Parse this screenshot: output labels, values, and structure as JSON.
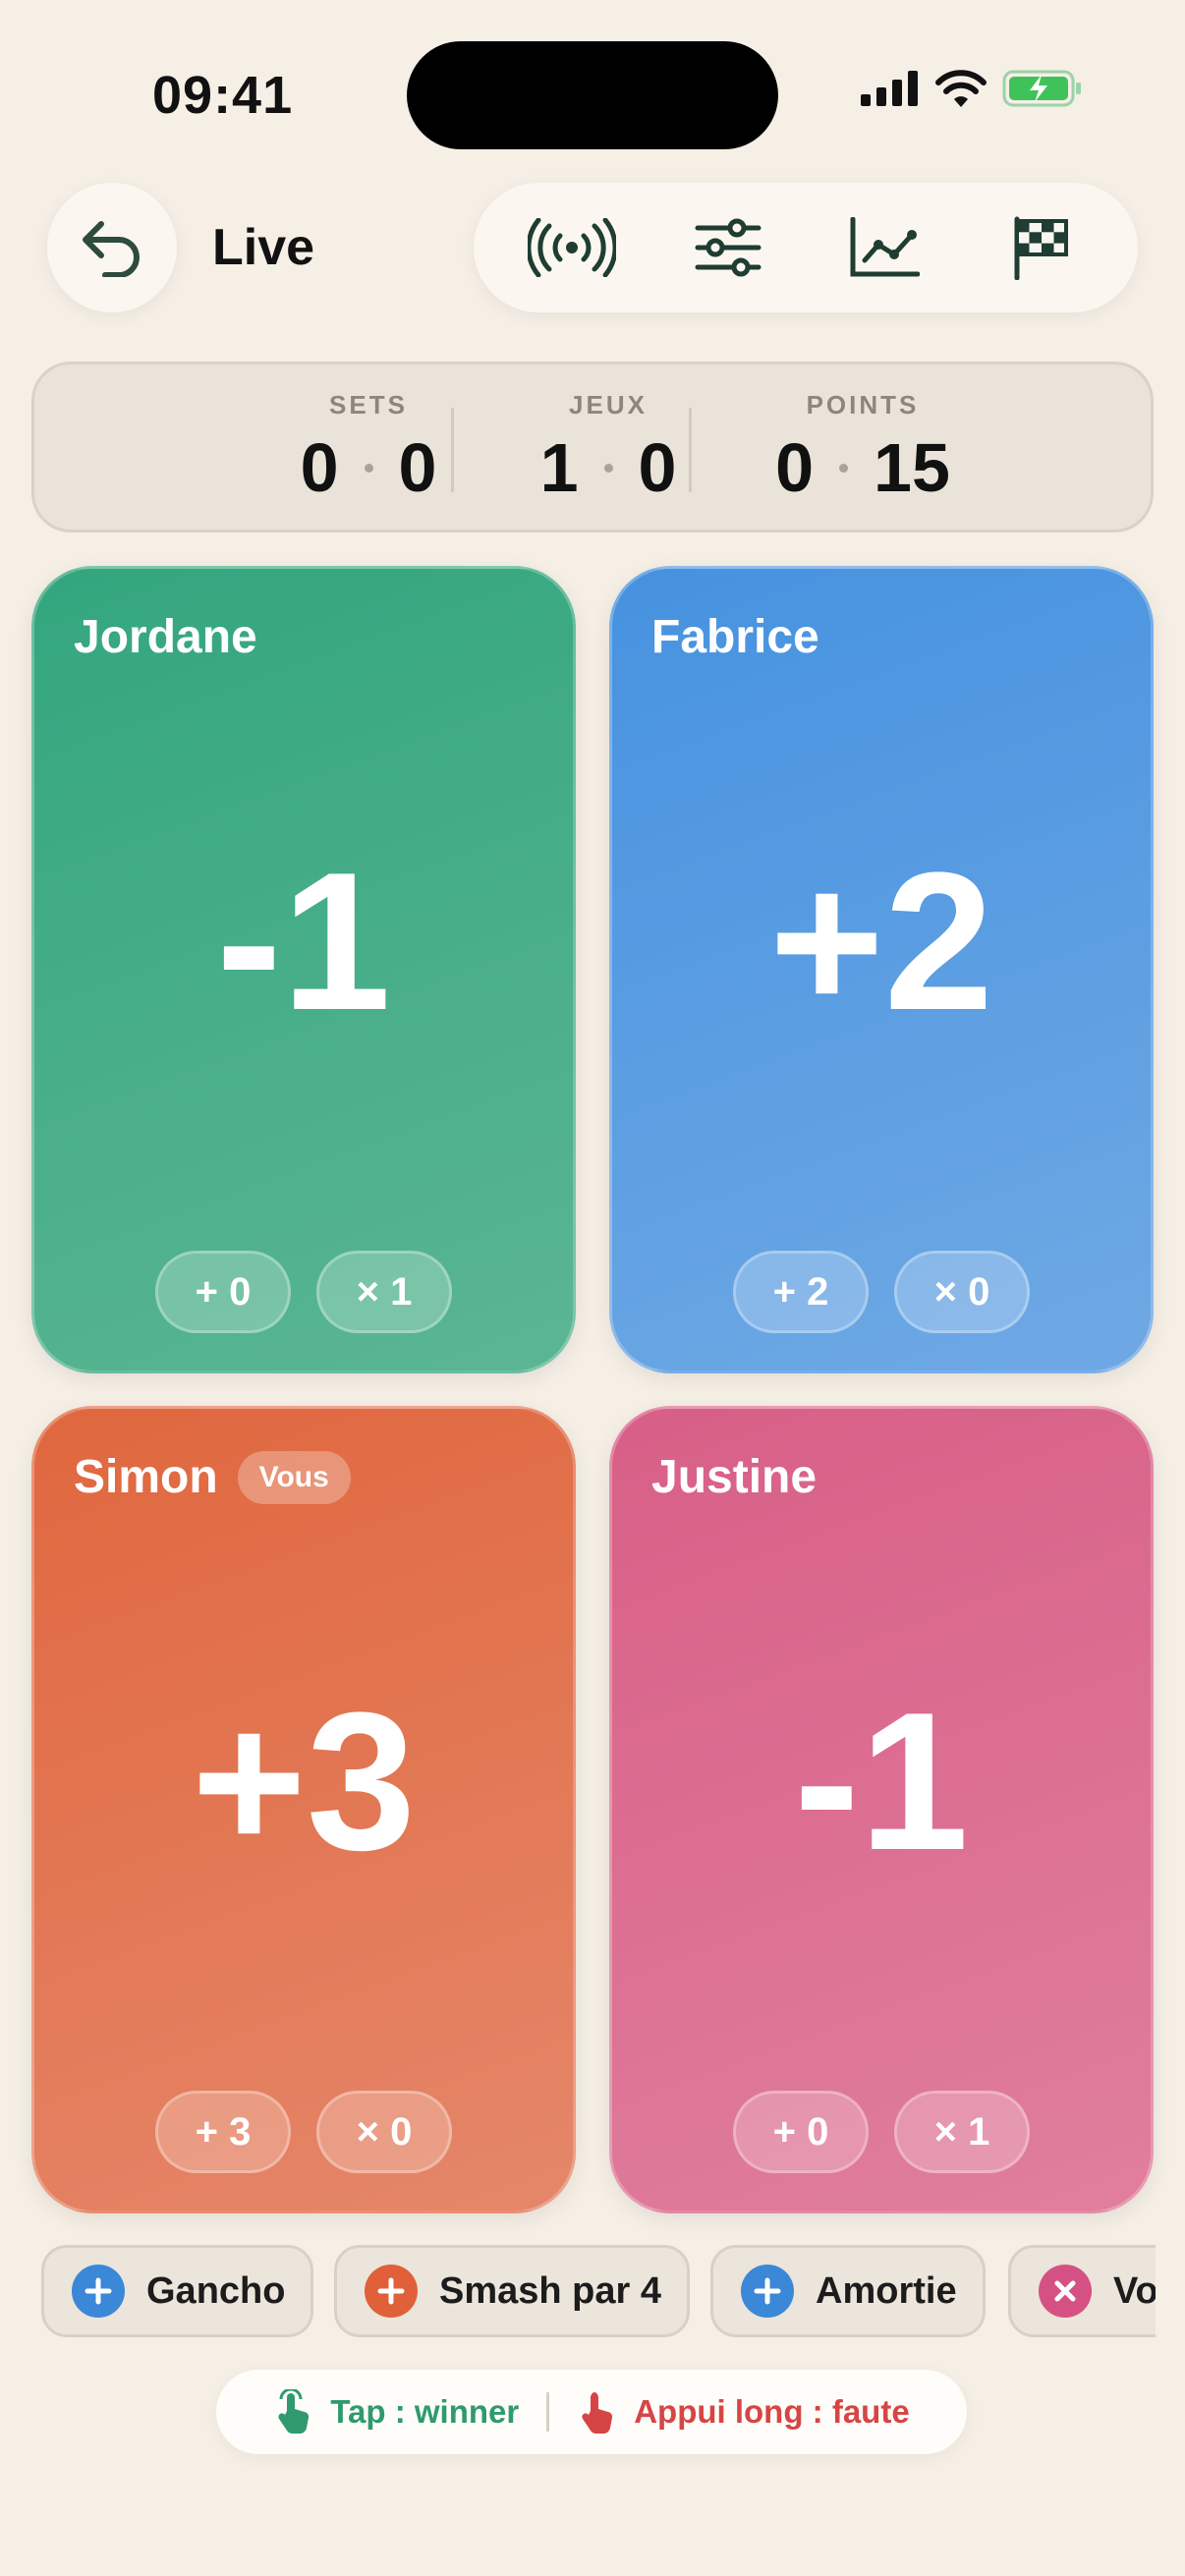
{
  "status_bar": {
    "time": "09:41"
  },
  "header": {
    "title": "Live"
  },
  "toolbar": {
    "icons": [
      "broadcast-icon",
      "sliders-icon",
      "chart-icon",
      "checkered-flag-icon"
    ]
  },
  "scoreboard": {
    "sets": {
      "label": "SETS",
      "a": "0",
      "b": "0"
    },
    "games": {
      "label": "JEUX",
      "a": "1",
      "b": "0"
    },
    "points": {
      "label": "POINTS",
      "a": "0",
      "b": "15"
    }
  },
  "players": [
    {
      "name": "Jordane",
      "score": "-1",
      "winners": "+ 0",
      "faults": "× 1",
      "color": "#3aa882"
    },
    {
      "name": "Fabrice",
      "score": "+2",
      "winners": "+ 2",
      "faults": "× 0",
      "color": "#4a94e0"
    },
    {
      "name": "Simon",
      "badge": "Vous",
      "score": "+3",
      "winners": "+ 3",
      "faults": "× 0",
      "color": "#e06b43"
    },
    {
      "name": "Justine",
      "score": "-1",
      "winners": "+ 0",
      "faults": "× 1",
      "color": "#d9638b"
    }
  ],
  "shots": [
    {
      "label": "Gancho",
      "type": "winner",
      "color": "#3b87d8"
    },
    {
      "label": "Smash par 4",
      "type": "winner",
      "color": "#e0603a"
    },
    {
      "label": "Amortie",
      "type": "winner",
      "color": "#3b87d8"
    },
    {
      "label": "Vo",
      "type": "fault",
      "color": "#d65183"
    }
  ],
  "hint": {
    "tap": "Tap : winner",
    "long_press": "Appui long : faute",
    "tap_color": "#2f9a6e",
    "long_press_color": "#d64545"
  }
}
